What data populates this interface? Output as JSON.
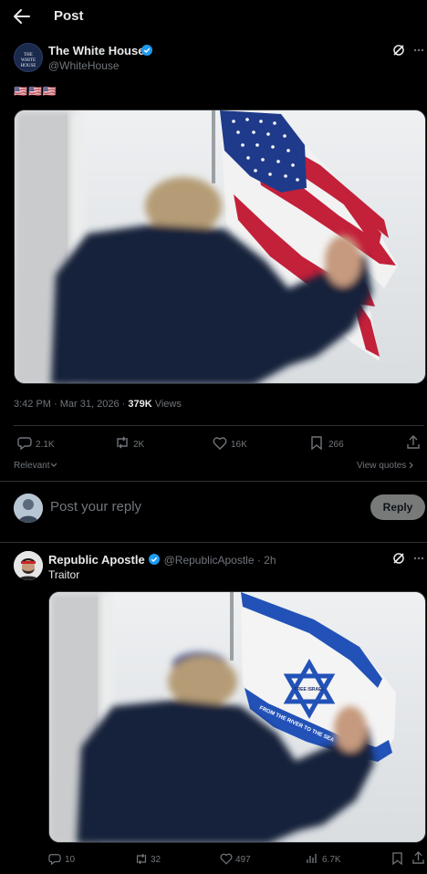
{
  "header": {
    "title": "Post"
  },
  "post": {
    "author_name": "The White House",
    "author_handle": "@WhiteHouse",
    "avatar_text": "THE WHITE HOUSE",
    "text": "🇺🇸🇺🇸🇺🇸",
    "timestamp": "3:42 PM · Mar 31, 2026 · ",
    "views_count": "379K",
    "views_label": " Views",
    "replies": "2.1K",
    "reposts": "2K",
    "likes": "16K",
    "bookmarks": "266"
  },
  "sort": {
    "label": "Relevant",
    "view_quotes": "View quotes"
  },
  "composer": {
    "placeholder": "Post your reply",
    "reply_button": "Reply"
  },
  "reply": {
    "author_name": "Republic Apostle",
    "author_handle": "@RepublicApostle · 2h",
    "text": "Traitor",
    "flag_text_star": "FREE ISRAEL",
    "flag_text_banner": "FROM THE RIVER TO THE SEA",
    "replies": "10",
    "reposts": "32",
    "likes": "497",
    "views": "6.7K"
  },
  "colors": {
    "accent": "#1d9bf0",
    "verified": "#1d9bf0",
    "background": "#000000",
    "border": "#2f3336"
  }
}
